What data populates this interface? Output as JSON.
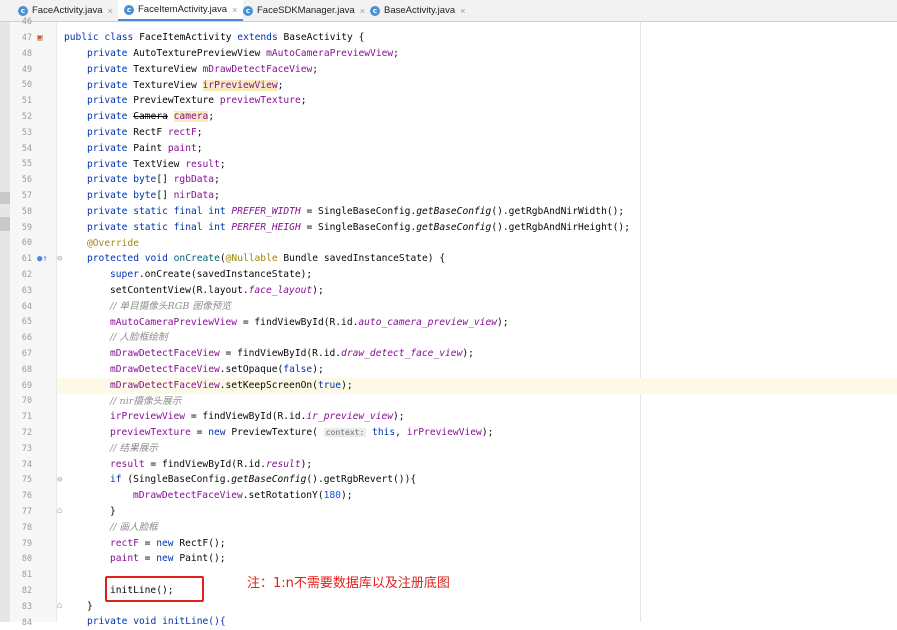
{
  "tabs": [
    {
      "label": "FaceActivity.java",
      "close": "×"
    },
    {
      "label": "FaceItemActivity.java",
      "close": "×"
    },
    {
      "label": "FaceSDKManager.java",
      "close": "×"
    },
    {
      "label": "BaseActivity.java",
      "close": "×"
    }
  ],
  "tab_icon_letter": "c",
  "line_numbers": [
    "46",
    "47",
    "48",
    "49",
    "50",
    "51",
    "52",
    "53",
    "54",
    "55",
    "56",
    "57",
    "58",
    "59",
    "60",
    "61",
    "62",
    "63",
    "64",
    "65",
    "66",
    "67",
    "68",
    "69",
    "70",
    "71",
    "72",
    "73",
    "74",
    "75",
    "76",
    "77",
    "78",
    "79",
    "80",
    "81",
    "82",
    "83",
    "84"
  ],
  "code": {
    "l47": {
      "a": "public class ",
      "b": "FaceItemActivity ",
      "c": "extends ",
      "d": "BaseActivity {"
    },
    "l48": {
      "a": "private ",
      "b": "AutoTexturePreviewView ",
      "c": "mAutoCameraPreviewView",
      "d": ";"
    },
    "l49": {
      "a": "private ",
      "b": "TextureView ",
      "c": "mDrawDetectFaceView",
      "d": ";"
    },
    "l50": {
      "a": "private ",
      "b": "TextureView ",
      "c": "irPreviewView",
      "d": ";"
    },
    "l51": {
      "a": "private ",
      "b": "PreviewTexture ",
      "c": "previewTexture",
      "d": ";"
    },
    "l52": {
      "a": "private ",
      "b": "Camera",
      "c": " ",
      "d": "camera",
      "e": ";"
    },
    "l53": {
      "a": "private ",
      "b": "RectF ",
      "c": "rectF",
      "d": ";"
    },
    "l54": {
      "a": "private ",
      "b": "Paint ",
      "c": "paint",
      "d": ";"
    },
    "l55": {
      "a": "private ",
      "b": "TextView ",
      "c": "result",
      "d": ";"
    },
    "l56": {
      "a": "private ",
      "b": "byte",
      "c": "[] ",
      "d": "rgbData",
      "e": ";"
    },
    "l57": {
      "a": "private ",
      "b": "byte",
      "c": "[] ",
      "d": "nirData",
      "e": ";"
    },
    "l58": {
      "a": "private static final int ",
      "b": "PREFER_WIDTH",
      "c": " = SingleBaseConfig.",
      "d": "getBaseConfig",
      "e": "().getRgbAndNirWidth();"
    },
    "l59": {
      "a": "private static final int ",
      "b": "PERFER_HEIGH",
      "c": " = SingleBaseConfig.",
      "d": "getBaseConfig",
      "e": "().getRgbAndNirHeight();"
    },
    "l60": {
      "a": "@Override"
    },
    "l61": {
      "a": "protected void ",
      "b": "onCreate",
      "c": "(",
      "d": "@Nullable",
      "e": " Bundle savedInstanceState) {"
    },
    "l62": {
      "a": "super",
      "b": ".onCreate(savedInstanceState);"
    },
    "l63": {
      "a": "setContentView(R.layout.",
      "b": "face_layout",
      "c": ");"
    },
    "l64": {
      "a": "// 单目摄像头RGB 图像预览"
    },
    "l65": {
      "a": "mAutoCameraPreviewView",
      "b": " = findViewById(R.id.",
      "c": "auto_camera_preview_view",
      "d": ");"
    },
    "l66": {
      "a": "// 人脸框绘制"
    },
    "l67": {
      "a": "mDrawDetectFaceView",
      "b": " = findViewById(R.id.",
      "c": "draw_detect_face_view",
      "d": ");"
    },
    "l68": {
      "a": "mDrawDetectFaceView",
      "b": ".setOpaque(",
      "c": "false",
      "d": ");"
    },
    "l69": {
      "a": "mDrawDetectFaceView",
      "b": ".setKeepScreenOn(",
      "c": "true",
      "d": ");"
    },
    "l70": {
      "a": "// nir摄像头展示"
    },
    "l71": {
      "a": "irPreviewView",
      "b": " = findViewById(R.id.",
      "c": "ir_preview_view",
      "d": ");"
    },
    "l72": {
      "a": "previewTexture",
      "b": " = ",
      "c": "new ",
      "d": "PreviewTexture( ",
      "e": "context:",
      "f": " this",
      "g": ", ",
      "h": "irPreviewView",
      "i": ");"
    },
    "l73": {
      "a": "// 结果展示"
    },
    "l74": {
      "a": "result",
      "b": " = findViewById(R.id.",
      "c": "result",
      "d": ");"
    },
    "l75": {
      "a": "if ",
      "b": "(SingleBaseConfig.",
      "c": "getBaseConfig",
      "d": "().getRgbRevert()){"
    },
    "l76": {
      "a": "mDrawDetectFaceView",
      "b": ".setRotationY(",
      "c": "180",
      "d": ");"
    },
    "l77": {
      "a": "}"
    },
    "l78": {
      "a": "// 画人脸框"
    },
    "l79": {
      "a": "rectF",
      "b": " = ",
      "c": "new ",
      "d": "RectF();"
    },
    "l80": {
      "a": "paint",
      "b": " = ",
      "c": "new ",
      "d": "Paint();"
    },
    "l82": {
      "a": "initLine();"
    },
    "l83": {
      "a": "}"
    },
    "l84": {
      "a": "private void initLine(){"
    }
  },
  "note": "注：1:n不需要数据库以及注册底图",
  "colors": {
    "keyword": "#0033b3",
    "field": "#871094",
    "comment": "#8c8c8c",
    "annotation": "#9e880d",
    "number": "#1750eb",
    "red": "#e0201c"
  },
  "icons": [
    "class-file-icon",
    "close-icon",
    "run-gutter-icon",
    "override-gutter-icon",
    "fold-icon"
  ]
}
